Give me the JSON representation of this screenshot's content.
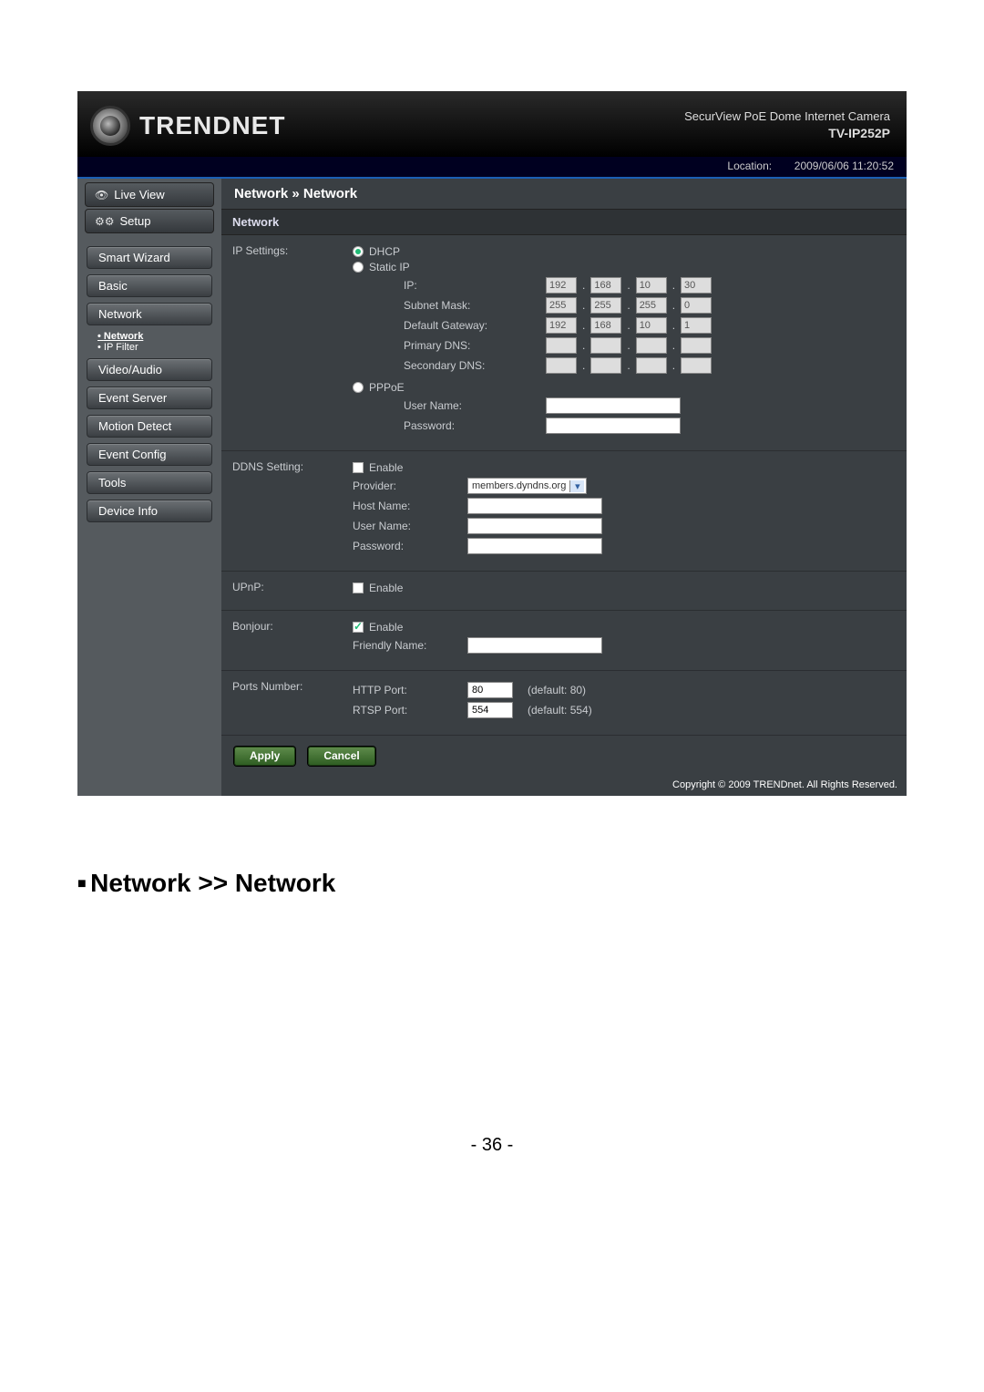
{
  "header": {
    "brand": "TRENDNET",
    "product_line1": "SecurView PoE Dome Internet Camera",
    "model": "TV-IP252P"
  },
  "location": {
    "label": "Location:",
    "datetime": "2009/06/06 11:20:52"
  },
  "sidebar": {
    "live": "Live View",
    "setup": "Setup",
    "items": {
      "smart_wizard": "Smart Wizard",
      "basic": "Basic",
      "network": "Network",
      "video_audio": "Video/Audio",
      "event_server": "Event Server",
      "motion_detect": "Motion Detect",
      "event_config": "Event Config",
      "tools": "Tools",
      "device_info": "Device Info"
    },
    "network_sub": {
      "network": "Network",
      "ipfilter": "IP Filter"
    }
  },
  "breadcrumb": "Network » Network",
  "section_network": "Network",
  "ip_settings": {
    "label": "IP Settings:",
    "dhcp": "DHCP",
    "static_ip": "Static IP",
    "pppoe": "PPPoE",
    "fields": {
      "ip": "IP:",
      "subnet": "Subnet Mask:",
      "gateway": "Default Gateway:",
      "pdns": "Primary DNS:",
      "sdns": "Secondary DNS:",
      "user": "User Name:",
      "pass": "Password:"
    },
    "values": {
      "ip": [
        "192",
        "168",
        "10",
        "30"
      ],
      "subnet": [
        "255",
        "255",
        "255",
        "0"
      ],
      "gateway": [
        "192",
        "168",
        "10",
        "1"
      ],
      "pdns": [
        "",
        "",
        "",
        ""
      ],
      "sdns": [
        "",
        "",
        "",
        ""
      ],
      "user": "",
      "pass": ""
    }
  },
  "ddns": {
    "label": "DDNS Setting:",
    "enable": "Enable",
    "provider_label": "Provider:",
    "provider_value": "members.dyndns.org",
    "host_label": "Host Name:",
    "user_label": "User Name:",
    "pass_label": "Password:"
  },
  "upnp": {
    "label": "UPnP:",
    "enable": "Enable"
  },
  "bonjour": {
    "label": "Bonjour:",
    "enable": "Enable",
    "friendly": "Friendly Name:"
  },
  "ports": {
    "label": "Ports Number:",
    "http_label": "HTTP Port:",
    "http_value": "80",
    "http_default": "(default: 80)",
    "rtsp_label": "RTSP Port:",
    "rtsp_value": "554",
    "rtsp_default": "(default: 554)"
  },
  "buttons": {
    "apply": "Apply",
    "cancel": "Cancel"
  },
  "copyright": "Copyright © 2009 TRENDnet. All Rights Reserved.",
  "doc": {
    "heading": "Network >> Network",
    "page": "- 36 -"
  }
}
